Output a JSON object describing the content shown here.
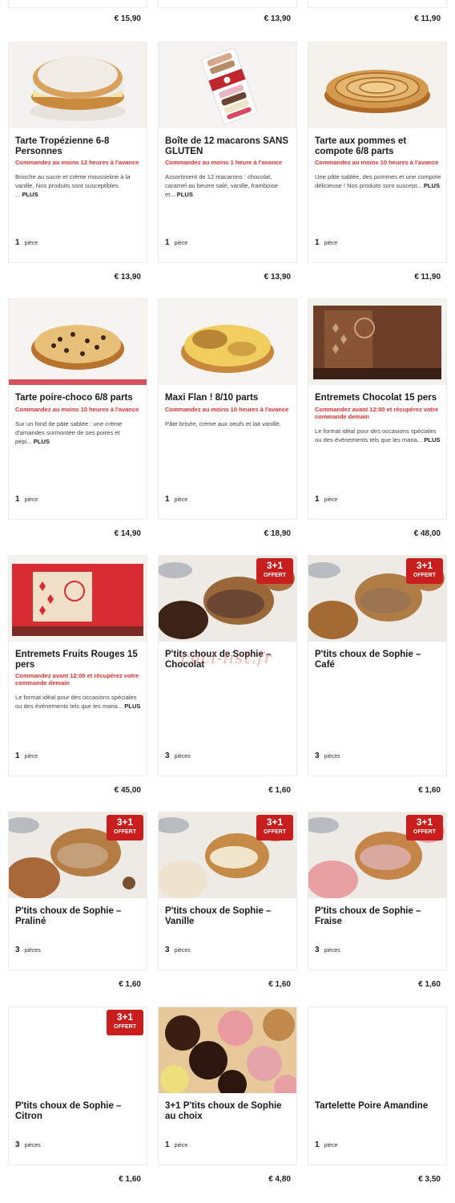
{
  "top_prices": [
    "€ 15,90",
    "€ 13,90",
    "€ 11,90"
  ],
  "products": [
    {
      "title": "Tarte Tropézienne 6-8 Personnes",
      "warning": "Commandez au moins 12 heures à l'avance",
      "description": "Brioche au sucre et crème mousseline à la vanille, Nos produits sont susceptibles ...",
      "more": "PLUS",
      "qty": "1",
      "unit": "pièce",
      "price": "€ 13,90",
      "image": "tropezienne-cake"
    },
    {
      "title": "Boîte de 12 macarons SANS GLUTEN",
      "warning": "Commandez au moins 1 heure à l'avance",
      "description": "Assortiment de 12 macarons : chocolat, caramel au beurre salé, vanille, framboise et...",
      "more": "PLUS",
      "qty": "1",
      "unit": "pièce",
      "price": "€ 13,90",
      "image": "macaron-box"
    },
    {
      "title": "Tarte aux pommes et compote 6/8 parts",
      "warning": "Commandez au moins 10 heures à l'avance",
      "description": "Une pâte sablée, des pommes et une compote délicieuse ! Nos produits sont suscept...",
      "more": "PLUS",
      "qty": "1",
      "unit": "pièce",
      "price": "€ 11,90",
      "image": "apple-tart"
    },
    {
      "title": "Tarte poire-choco 6/8 parts",
      "warning": "Commandez au moins 10 heures à l'avance",
      "description": "Sur un fond de pâte sablée : une crème d'amandes surmontée de ses poires et pépi...",
      "more": "PLUS",
      "qty": "1",
      "unit": "pièce",
      "price": "€ 14,90",
      "image": "pear-choco-tart"
    },
    {
      "title": "Maxi Flan ! 8/10 parts",
      "warning": "Commandez au moins 10 heures à l'avance",
      "description": "Pâte brisée, crème aux oeufs et lait vanillé,",
      "more": "",
      "qty": "1",
      "unit": "pièce",
      "price": "€ 18,90",
      "image": "flan"
    },
    {
      "title": "Entremets Chocolat 15 pers",
      "warning": "Commandez avant 12:00 et récupérez votre commande demain",
      "description": "Le format idéal pour des occasions spéciales ou des événements tels que les maria...",
      "more": "PLUS",
      "qty": "1",
      "unit": "pièce",
      "price": "€ 48,00",
      "image": "chocolate-entremets"
    },
    {
      "title": "Entremets Fruits Rouges 15 pers",
      "warning": "Commandez avant 12:00 et récupérez votre commande demain",
      "description": "Le format idéal pour des occasions spéciales ou des événements tels que les maria...",
      "more": "PLUS",
      "qty": "1",
      "unit": "pièce",
      "price": "€ 45,00",
      "image": "red-fruit-entremets"
    },
    {
      "title": "P'tits choux de Sophie – Chocolat",
      "warning": "",
      "description": "",
      "more": "",
      "qty": "3",
      "unit": "pièces",
      "price": "€ 1,60",
      "image": "choux-chocolate",
      "badge": {
        "big": "3+1",
        "small": "OFFERT"
      }
    },
    {
      "title": "P'tits choux de Sophie – Café",
      "warning": "",
      "description": "",
      "more": "",
      "qty": "3",
      "unit": "pièces",
      "price": "€ 1,60",
      "image": "choux-coffee",
      "badge": {
        "big": "3+1",
        "small": "OFFERT"
      }
    },
    {
      "title": "P'tits choux de Sophie – Praliné",
      "warning": "",
      "description": "",
      "more": "",
      "qty": "3",
      "unit": "pièces",
      "price": "€ 1,60",
      "image": "choux-praline",
      "badge": {
        "big": "3+1",
        "small": "OFFERT"
      }
    },
    {
      "title": "P'tits choux de Sophie – Vanille",
      "warning": "",
      "description": "",
      "more": "",
      "qty": "3",
      "unit": "pièces",
      "price": "€ 1,60",
      "image": "choux-vanilla",
      "badge": {
        "big": "3+1",
        "small": "OFFERT"
      }
    },
    {
      "title": "P'tits choux de Sophie – Fraise",
      "warning": "",
      "description": "",
      "more": "",
      "qty": "3",
      "unit": "pièces",
      "price": "€ 1,60",
      "image": "choux-strawberry",
      "badge": {
        "big": "3+1",
        "small": "OFFERT"
      }
    },
    {
      "title": "P'tits choux de Sophie – Citron",
      "warning": "",
      "description": "",
      "more": "",
      "qty": "3",
      "unit": "pièces",
      "price": "€ 1,60",
      "image": "none",
      "badge": {
        "big": "3+1",
        "small": "OFFERT"
      }
    },
    {
      "title": "3+1 P'tits choux de Sophie au choix",
      "warning": "",
      "description": "",
      "more": "",
      "qty": "1",
      "unit": "pièce",
      "price": "€ 4,80",
      "image": "choux-assortment"
    },
    {
      "title": "Tartelette Poire Amandine",
      "warning": "",
      "description": "",
      "more": "",
      "qty": "1",
      "unit": "pièce",
      "price": "€ 3,50",
      "image": "none"
    }
  ],
  "watermark": "cacl-list.fr"
}
